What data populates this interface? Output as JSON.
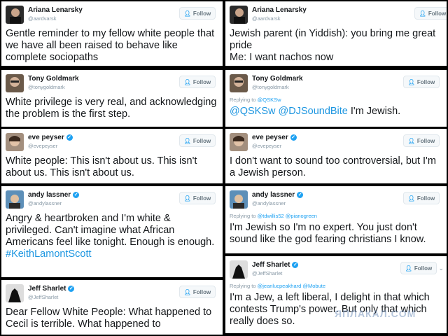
{
  "follow_label": "Follow",
  "left": [
    {
      "name": "Ariana Lenarsky",
      "handle": "@aardvarsk",
      "verified": false,
      "reply_prefix": "",
      "reply_mentions": "",
      "text": "Gentle reminder to my fellow white people that we have all been raised to behave like complete sociopaths",
      "hashtag": ""
    },
    {
      "name": "Tony Goldmark",
      "handle": "@tonygoldmark",
      "verified": false,
      "reply_prefix": "",
      "reply_mentions": "",
      "text": "White privilege is very real, and acknowledging the problem is the first step.",
      "hashtag": ""
    },
    {
      "name": "eve peyser",
      "handle": "@evepeyser",
      "verified": true,
      "reply_prefix": "",
      "reply_mentions": "",
      "text": "White people: This isn't about us. This isn't about us. This isn't about us.",
      "hashtag": ""
    },
    {
      "name": "andy lassner",
      "handle": "@andylassner",
      "verified": true,
      "reply_prefix": "",
      "reply_mentions": "",
      "text": "Angry & heartbroken and I'm white & privileged. Can't imagine what African Americans feel like tonight. Enough is enough.",
      "hashtag": "#KeithLamontScott"
    },
    {
      "name": "Jeff Sharlet",
      "handle": "@JeffSharlet",
      "verified": true,
      "reply_prefix": "",
      "reply_mentions": "",
      "text": "Dear Fellow White People: What happened to Cecil is terrible. What happened to",
      "hashtag": ""
    }
  ],
  "right": [
    {
      "name": "Ariana Lenarsky",
      "handle": "@aardvarsk",
      "verified": false,
      "reply_prefix": "",
      "reply_mentions": "",
      "text": "Jewish parent (in Yiddish): you bring me great pride\nMe: I want nachos now",
      "hashtag": ""
    },
    {
      "name": "Tony Goldmark",
      "handle": "@tonygoldmark",
      "verified": false,
      "reply_prefix": "Replying to",
      "reply_mentions": "@QSKSw",
      "text": "I'm Jewish.",
      "lead_mentions": "@QSKSw @DJSoundBite",
      "hashtag": ""
    },
    {
      "name": "eve peyser",
      "handle": "@evepeyser",
      "verified": true,
      "reply_prefix": "",
      "reply_mentions": "",
      "text": "I don't want to sound too controversial, but I'm a Jewish person.",
      "hashtag": ""
    },
    {
      "name": "andy lassner",
      "handle": "@andylassner",
      "verified": true,
      "reply_prefix": "Replying to",
      "reply_mentions": "@tdwillis52 @pianogreen",
      "text": "I'm Jewish so I'm no expert. You just don't sound like the god fearing christians I know.",
      "hashtag": ""
    },
    {
      "name": "Jeff Sharlet",
      "handle": "@JeffSharlet",
      "verified": true,
      "reply_prefix": "Replying to",
      "reply_mentions": "@jeanlucpeakhard @Mobute",
      "text": "I'm a Jew, a left liberal, I delight in that which contests Trump's power. But only that which really does so.",
      "hashtag": ""
    }
  ],
  "watermark": "ЯПЛАКАЛ.COM"
}
